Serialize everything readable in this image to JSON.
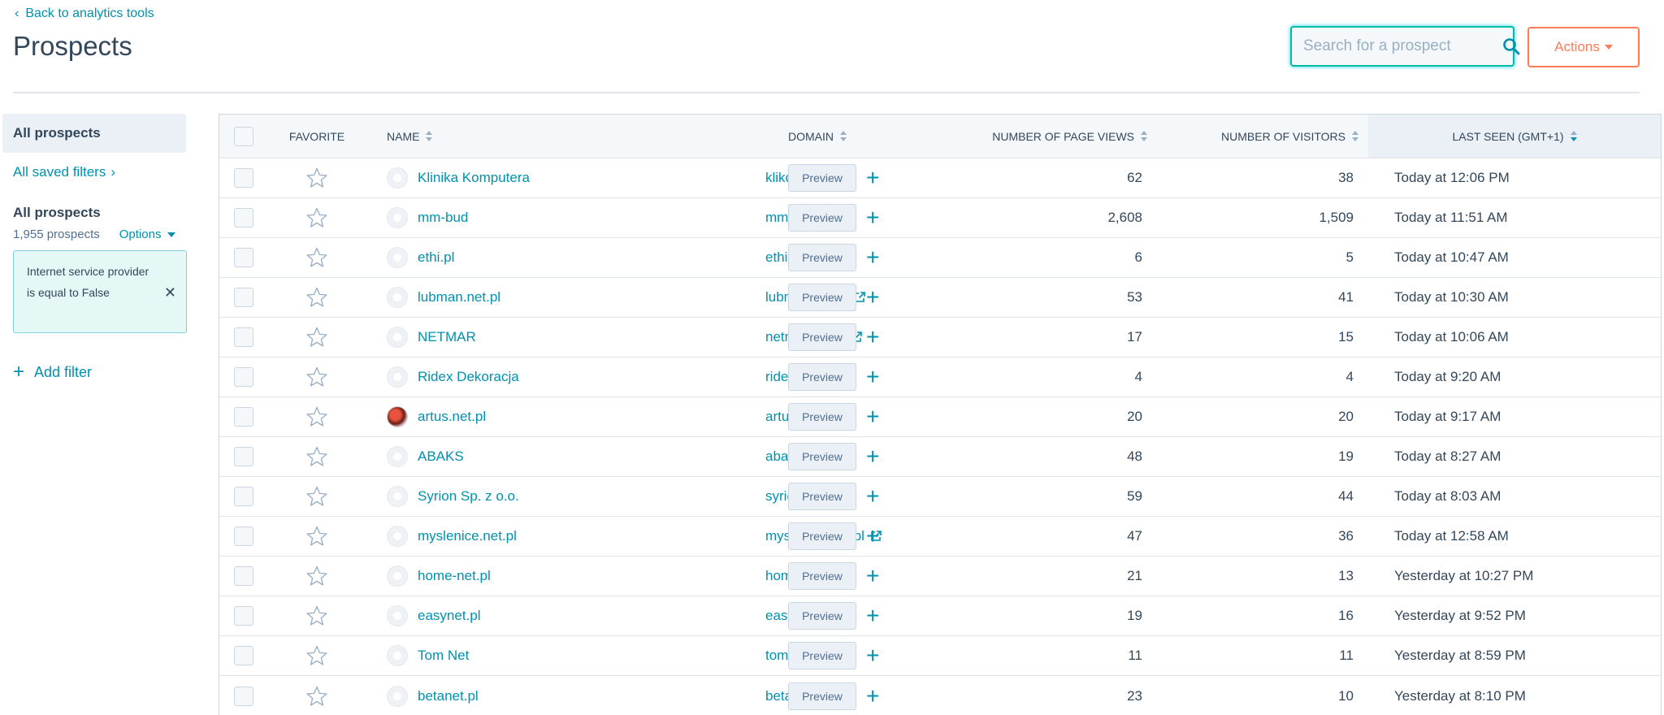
{
  "header": {
    "back_label": "Back to analytics tools",
    "title": "Prospects",
    "search_placeholder": "Search for a prospect",
    "actions_label": "Actions"
  },
  "sidebar": {
    "all_prospects": "All prospects",
    "saved_filters": "All saved filters",
    "group_title": "All prospects",
    "count": "1,955 prospects",
    "options_label": "Options",
    "filter_text": "Internet service provider is equal to False",
    "add_filter": "Add filter"
  },
  "table": {
    "columns": {
      "favorite": "FAVORITE",
      "name": "NAME",
      "domain": "DOMAIN",
      "views": "NUMBER OF PAGE VIEWS",
      "visitors": "NUMBER OF VISITORS",
      "last_seen": "LAST SEEN (GMT+1)"
    },
    "preview_label": "Preview",
    "rows": [
      {
        "name": "Klinika Komputera",
        "domain": "klikom.net",
        "views": "62",
        "visitors": "38",
        "last_seen": "Today at 12:06 PM",
        "avatar": "globe-icon"
      },
      {
        "name": "mm-bud",
        "domain": "mm.pl",
        "views": "2,608",
        "visitors": "1,509",
        "last_seen": "Today at 11:51 AM",
        "avatar": "globe-icon"
      },
      {
        "name": "ethi.pl",
        "domain": "ethi.pl",
        "views": "6",
        "visitors": "5",
        "last_seen": "Today at 10:47 AM",
        "avatar": "globe-icon"
      },
      {
        "name": "lubman.net.pl",
        "domain": "lubman.net.pl",
        "views": "53",
        "visitors": "41",
        "last_seen": "Today at 10:30 AM",
        "avatar": "globe-icon"
      },
      {
        "name": "NETMAR",
        "domain": "netmar.net.pl",
        "views": "17",
        "visitors": "15",
        "last_seen": "Today at 10:06 AM",
        "avatar": "globe-icon"
      },
      {
        "name": "Ridex Dekoracja",
        "domain": "ridex.pl",
        "views": "4",
        "visitors": "4",
        "last_seen": "Today at 9:20 AM",
        "avatar": "globe-icon"
      },
      {
        "name": "artus.net.pl",
        "domain": "artus.net.pl",
        "views": "20",
        "visitors": "20",
        "last_seen": "Today at 9:17 AM",
        "avatar": "company-logo"
      },
      {
        "name": "ABAKS",
        "domain": "abaks.pl",
        "views": "48",
        "visitors": "19",
        "last_seen": "Today at 8:27 AM",
        "avatar": "globe-icon"
      },
      {
        "name": "Syrion Sp. z o.o.",
        "domain": "syrion.pl",
        "views": "59",
        "visitors": "44",
        "last_seen": "Today at 8:03 AM",
        "avatar": "globe-icon"
      },
      {
        "name": "myslenice.net.pl",
        "domain": "myslenice.net.pl",
        "views": "47",
        "visitors": "36",
        "last_seen": "Today at 12:58 AM",
        "avatar": "globe-icon"
      },
      {
        "name": "home-net.pl",
        "domain": "home-net.pl",
        "views": "21",
        "visitors": "13",
        "last_seen": "Yesterday at 10:27 PM",
        "avatar": "globe-icon"
      },
      {
        "name": "easynet.pl",
        "domain": "easynet.pl",
        "views": "19",
        "visitors": "16",
        "last_seen": "Yesterday at 9:52 PM",
        "avatar": "globe-icon"
      },
      {
        "name": "Tom Net",
        "domain": "tom-net.pl",
        "views": "11",
        "visitors": "11",
        "last_seen": "Yesterday at 8:59 PM",
        "avatar": "globe-icon"
      },
      {
        "name": "betanet.pl",
        "domain": "betanet.pl",
        "views": "23",
        "visitors": "10",
        "last_seen": "Yesterday at 8:10 PM",
        "avatar": "globe-icon"
      }
    ]
  },
  "colors": {
    "accent": "#0091ae",
    "actions": "#ff7a59",
    "text": "#33475b"
  }
}
